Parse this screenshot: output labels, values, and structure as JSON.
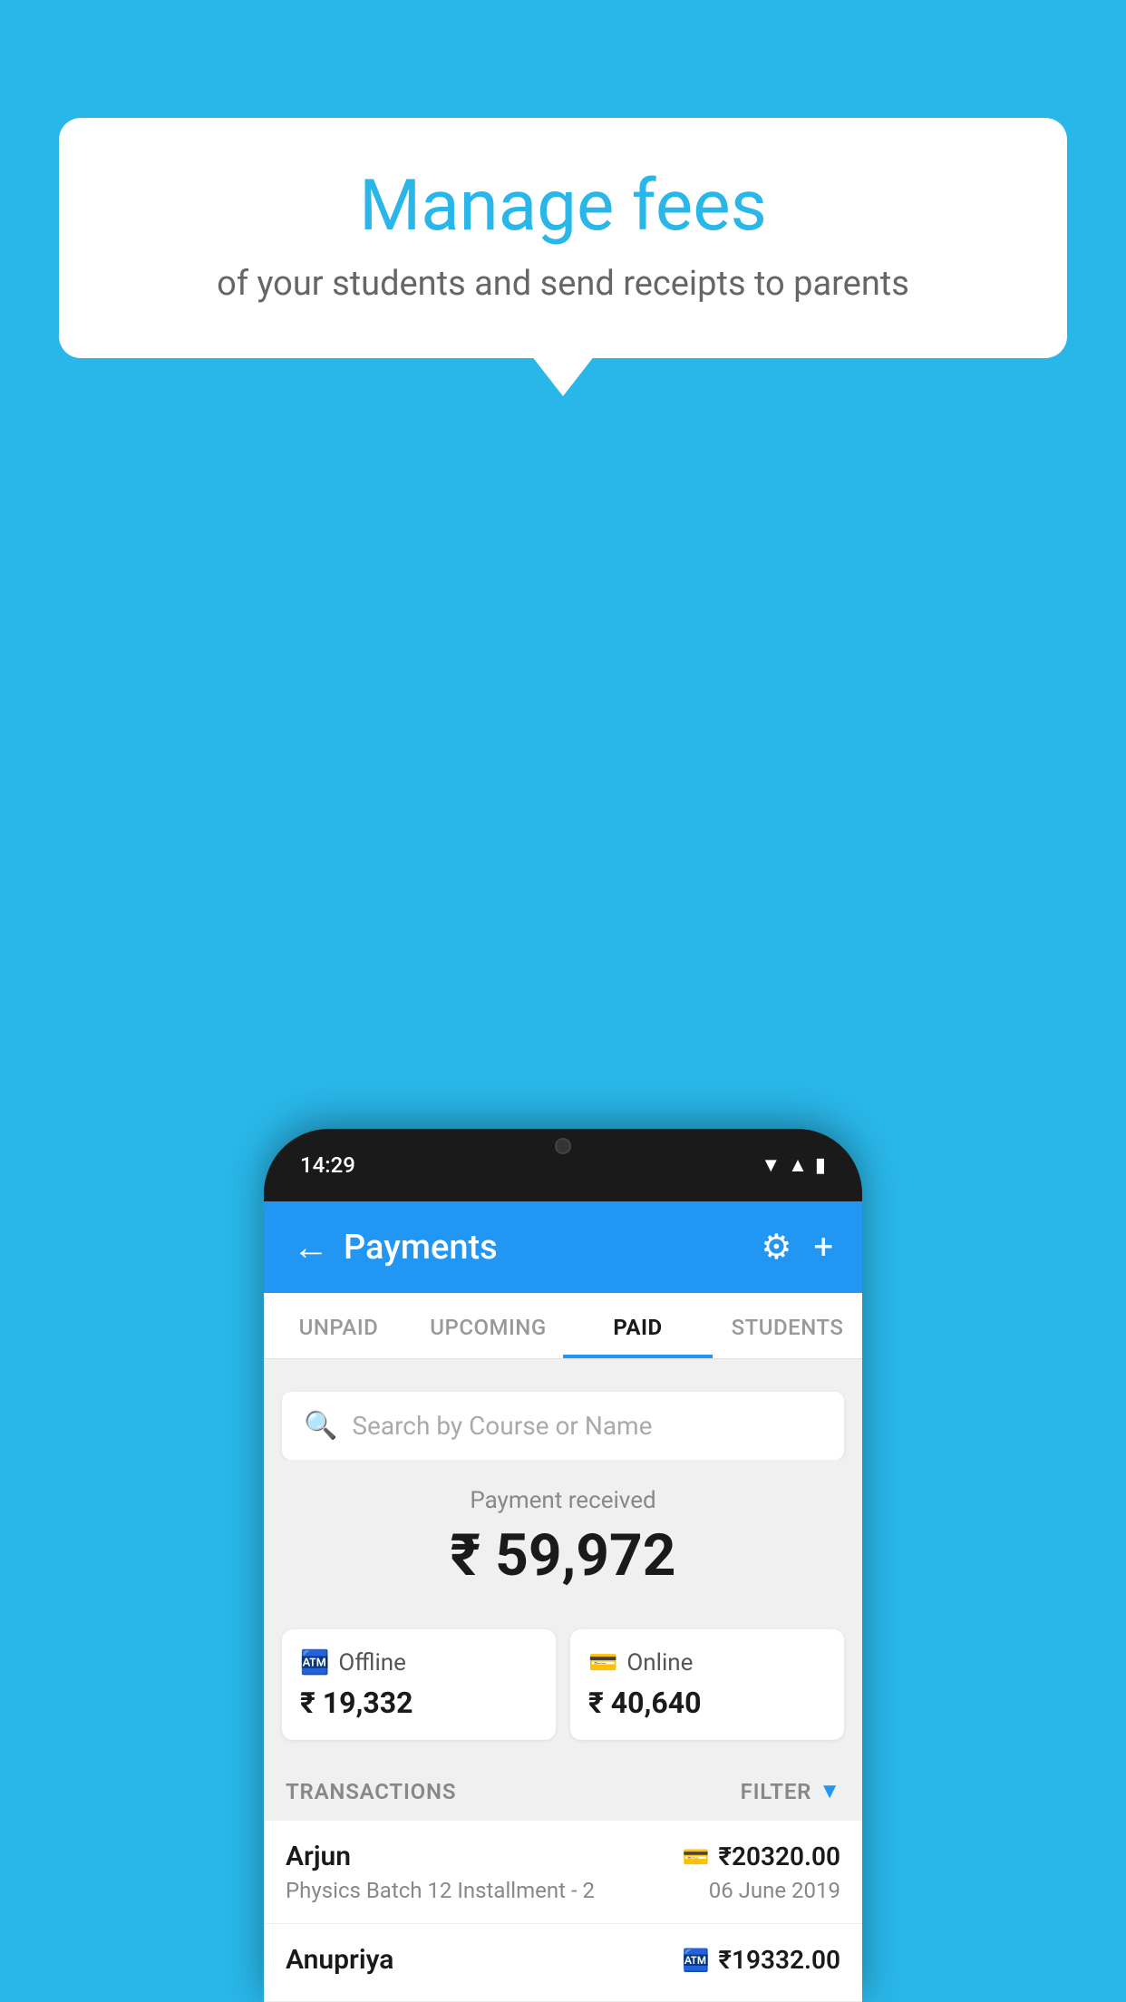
{
  "background_color": "#29B6E8",
  "speech_bubble": {
    "title": "Manage fees",
    "subtitle": "of your students and send receipts to parents"
  },
  "phone": {
    "status_bar": {
      "time": "14:29"
    },
    "header": {
      "back_label": "←",
      "title": "Payments",
      "gear_icon": "⚙",
      "plus_icon": "+"
    },
    "tabs": [
      {
        "label": "UNPAID",
        "active": false
      },
      {
        "label": "UPCOMING",
        "active": false
      },
      {
        "label": "PAID",
        "active": true
      },
      {
        "label": "STUDENTS",
        "active": false
      }
    ],
    "search": {
      "placeholder": "Search by Course or Name"
    },
    "payment_received": {
      "label": "Payment received",
      "amount": "₹ 59,972",
      "offline": {
        "label": "Offline",
        "amount": "₹ 19,332"
      },
      "online": {
        "label": "Online",
        "amount": "₹ 40,640"
      }
    },
    "transactions": {
      "header_label": "TRANSACTIONS",
      "filter_label": "FILTER",
      "rows": [
        {
          "name": "Arjun",
          "description": "Physics Batch 12 Installment - 2",
          "amount": "₹20320.00",
          "date": "06 June 2019",
          "mode": "card"
        },
        {
          "name": "Anupriya",
          "description": "",
          "amount": "₹19332.00",
          "date": "",
          "mode": "cash"
        }
      ]
    }
  }
}
